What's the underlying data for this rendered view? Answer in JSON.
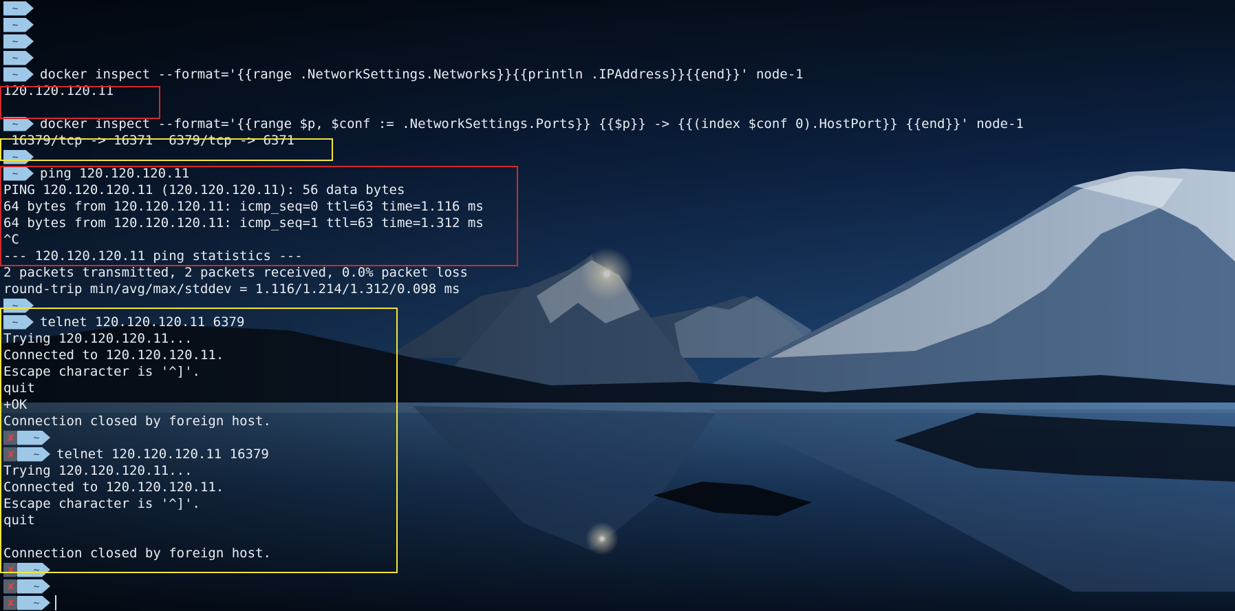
{
  "terminal": {
    "prompt_dir": "~",
    "error_mark": "✘",
    "colors": {
      "text": "#e9edf2",
      "prompt_bg": "#9ec8e8",
      "error_bg": "#56606e",
      "error_mark": "#e0433b",
      "red_box": "#d42a2a",
      "yellow_box": "#f2e63a"
    },
    "lines": [
      {
        "kind": "prompt",
        "text": ""
      },
      {
        "kind": "prompt",
        "text": ""
      },
      {
        "kind": "prompt",
        "text": ""
      },
      {
        "kind": "prompt",
        "text": ""
      },
      {
        "kind": "prompt",
        "text": "docker inspect --format='{{range .NetworkSettings.Networks}}{{println .IPAddress}}{{end}}' node-1"
      },
      {
        "kind": "output",
        "text": "120.120.120.11"
      },
      {
        "kind": "output",
        "text": ""
      },
      {
        "kind": "prompt",
        "text": "docker inspect --format='{{range $p, $conf := .NetworkSettings.Ports}} {{$p}} -> {{(index $conf 0).HostPort}} {{end}}' node-1"
      },
      {
        "kind": "output",
        "text": " 16379/tcp -> 16371  6379/tcp -> 6371"
      },
      {
        "kind": "prompt",
        "text": ""
      },
      {
        "kind": "prompt",
        "text": "ping 120.120.120.11"
      },
      {
        "kind": "output",
        "text": "PING 120.120.120.11 (120.120.120.11): 56 data bytes"
      },
      {
        "kind": "output",
        "text": "64 bytes from 120.120.120.11: icmp_seq=0 ttl=63 time=1.116 ms"
      },
      {
        "kind": "output",
        "text": "64 bytes from 120.120.120.11: icmp_seq=1 ttl=63 time=1.312 ms"
      },
      {
        "kind": "output",
        "text": "^C"
      },
      {
        "kind": "output",
        "text": "--- 120.120.120.11 ping statistics ---"
      },
      {
        "kind": "output",
        "text": "2 packets transmitted, 2 packets received, 0.0% packet loss"
      },
      {
        "kind": "output",
        "text": "round-trip min/avg/max/stddev = 1.116/1.214/1.312/0.098 ms"
      },
      {
        "kind": "prompt",
        "text": ""
      },
      {
        "kind": "prompt",
        "text": "telnet 120.120.120.11 6379"
      },
      {
        "kind": "output",
        "text": "Trying 120.120.120.11..."
      },
      {
        "kind": "output",
        "text": "Connected to 120.120.120.11."
      },
      {
        "kind": "output",
        "text": "Escape character is '^]'."
      },
      {
        "kind": "output",
        "text": "quit"
      },
      {
        "kind": "output",
        "text": "+OK"
      },
      {
        "kind": "output",
        "text": "Connection closed by foreign host."
      },
      {
        "kind": "prompt_err",
        "text": ""
      },
      {
        "kind": "prompt_err",
        "text": "telnet 120.120.120.11 16379"
      },
      {
        "kind": "output",
        "text": "Trying 120.120.120.11..."
      },
      {
        "kind": "output",
        "text": "Connected to 120.120.120.11."
      },
      {
        "kind": "output",
        "text": "Escape character is '^]'."
      },
      {
        "kind": "output",
        "text": "quit"
      },
      {
        "kind": "output",
        "text": ""
      },
      {
        "kind": "output",
        "text": "Connection closed by foreign host."
      },
      {
        "kind": "prompt_err",
        "text": ""
      },
      {
        "kind": "prompt_err",
        "text": ""
      },
      {
        "kind": "prompt_err_cursor",
        "text": ""
      }
    ]
  }
}
